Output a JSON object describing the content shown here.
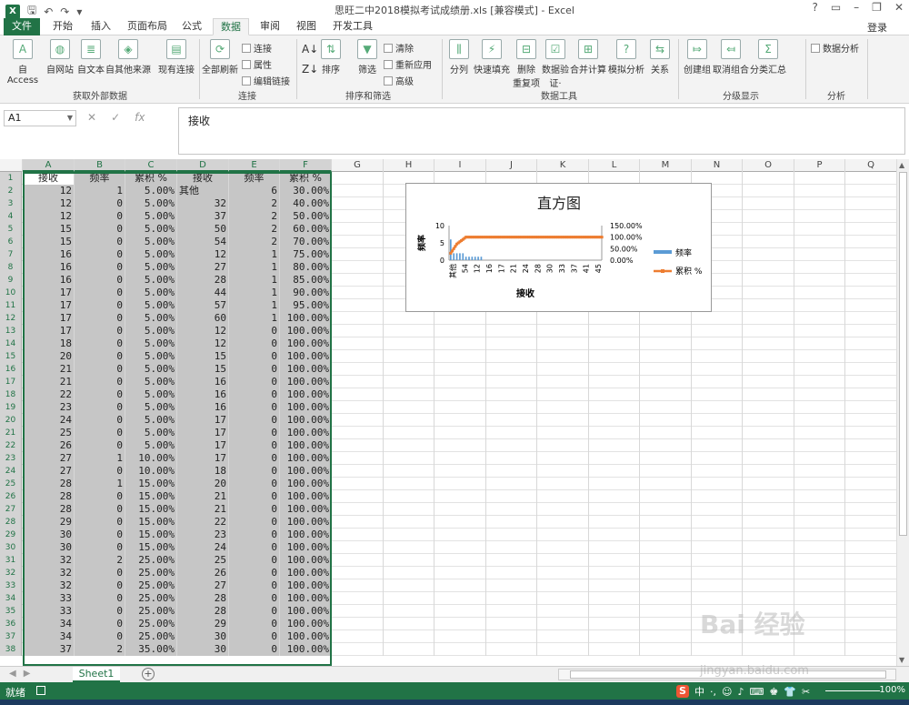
{
  "window": {
    "title": "思旺二中2018模拟考试成绩册.xls  [兼容模式] - Excel",
    "buttons": [
      "?",
      "▭",
      "–",
      "❐",
      "✕"
    ]
  },
  "tabs": [
    {
      "label": "文件",
      "kind": "file"
    },
    {
      "label": "开始"
    },
    {
      "label": "插入"
    },
    {
      "label": "页面布局"
    },
    {
      "label": "公式"
    },
    {
      "label": "数据",
      "active": true
    },
    {
      "label": "审阅"
    },
    {
      "label": "视图"
    },
    {
      "label": "开发工具"
    }
  ],
  "login": "登录",
  "ribbon": {
    "buttons": [
      {
        "label": "自 Access",
        "icon": "access-icon"
      },
      {
        "label": "自网站",
        "icon": "web-icon"
      },
      {
        "label": "自文本",
        "icon": "text-file-icon"
      },
      {
        "label": "自其他来源",
        "icon": "other-sources-icon"
      },
      {
        "label": "现有连接",
        "icon": "existing-connections-icon"
      },
      {
        "label": "全部刷新",
        "icon": "refresh-icon"
      },
      {
        "label": "排序",
        "icon": "sort-icon"
      },
      {
        "label": "筛选",
        "icon": "filter-icon"
      },
      {
        "label": "分列",
        "icon": "text-to-columns-icon"
      },
      {
        "label": "快速填充",
        "icon": "flash-fill-icon"
      },
      {
        "label": "删除\n重复项",
        "icon": "remove-duplicates-icon"
      },
      {
        "label": "数据验\n证·",
        "icon": "data-validation-icon"
      },
      {
        "label": "合并计算",
        "icon": "consolidate-icon"
      },
      {
        "label": "模拟分析",
        "icon": "what-if-icon"
      },
      {
        "label": "关系",
        "icon": "relationships-icon"
      },
      {
        "label": "创建组",
        "icon": "group-icon"
      },
      {
        "label": "取消组合",
        "icon": "ungroup-icon"
      },
      {
        "label": "分类汇总",
        "icon": "subtotal-icon"
      }
    ],
    "small_buttons": [
      {
        "label": "连接"
      },
      {
        "label": "属性"
      },
      {
        "label": "编辑链接"
      },
      {
        "label": "清除"
      },
      {
        "label": "重新应用"
      },
      {
        "label": "高级"
      },
      {
        "label": "数据分析"
      }
    ],
    "groups": [
      "获取外部数据",
      "连接",
      "排序和筛选",
      "数据工具",
      "分级显示",
      "分析"
    ]
  },
  "formula_bar": {
    "name_box": "A1",
    "value": "接收",
    "icons": [
      "✕",
      "✓",
      "fx"
    ]
  },
  "columns": [
    "A",
    "B",
    "C",
    "D",
    "E",
    "F",
    "G",
    "H",
    "I",
    "J",
    "K",
    "L",
    "M",
    "N",
    "O",
    "P",
    "Q"
  ],
  "table": {
    "headers": [
      "接收",
      "频率",
      "累积 %",
      "接收",
      "频率",
      "累积 %"
    ],
    "rows": [
      [
        "12",
        "1",
        "5.00%",
        "其他",
        "6",
        "30.00%"
      ],
      [
        "12",
        "0",
        "5.00%",
        "32",
        "2",
        "40.00%"
      ],
      [
        "12",
        "0",
        "5.00%",
        "37",
        "2",
        "50.00%"
      ],
      [
        "15",
        "0",
        "5.00%",
        "50",
        "2",
        "60.00%"
      ],
      [
        "15",
        "0",
        "5.00%",
        "54",
        "2",
        "70.00%"
      ],
      [
        "16",
        "0",
        "5.00%",
        "12",
        "1",
        "75.00%"
      ],
      [
        "16",
        "0",
        "5.00%",
        "27",
        "1",
        "80.00%"
      ],
      [
        "16",
        "0",
        "5.00%",
        "28",
        "1",
        "85.00%"
      ],
      [
        "17",
        "0",
        "5.00%",
        "44",
        "1",
        "90.00%"
      ],
      [
        "17",
        "0",
        "5.00%",
        "57",
        "1",
        "95.00%"
      ],
      [
        "17",
        "0",
        "5.00%",
        "60",
        "1",
        "100.00%"
      ],
      [
        "17",
        "0",
        "5.00%",
        "12",
        "0",
        "100.00%"
      ],
      [
        "18",
        "0",
        "5.00%",
        "12",
        "0",
        "100.00%"
      ],
      [
        "20",
        "0",
        "5.00%",
        "15",
        "0",
        "100.00%"
      ],
      [
        "21",
        "0",
        "5.00%",
        "15",
        "0",
        "100.00%"
      ],
      [
        "21",
        "0",
        "5.00%",
        "16",
        "0",
        "100.00%"
      ],
      [
        "22",
        "0",
        "5.00%",
        "16",
        "0",
        "100.00%"
      ],
      [
        "23",
        "0",
        "5.00%",
        "16",
        "0",
        "100.00%"
      ],
      [
        "24",
        "0",
        "5.00%",
        "17",
        "0",
        "100.00%"
      ],
      [
        "25",
        "0",
        "5.00%",
        "17",
        "0",
        "100.00%"
      ],
      [
        "26",
        "0",
        "5.00%",
        "17",
        "0",
        "100.00%"
      ],
      [
        "27",
        "1",
        "10.00%",
        "17",
        "0",
        "100.00%"
      ],
      [
        "27",
        "0",
        "10.00%",
        "18",
        "0",
        "100.00%"
      ],
      [
        "28",
        "1",
        "15.00%",
        "20",
        "0",
        "100.00%"
      ],
      [
        "28",
        "0",
        "15.00%",
        "21",
        "0",
        "100.00%"
      ],
      [
        "28",
        "0",
        "15.00%",
        "21",
        "0",
        "100.00%"
      ],
      [
        "29",
        "0",
        "15.00%",
        "22",
        "0",
        "100.00%"
      ],
      [
        "30",
        "0",
        "15.00%",
        "23",
        "0",
        "100.00%"
      ],
      [
        "30",
        "0",
        "15.00%",
        "24",
        "0",
        "100.00%"
      ],
      [
        "32",
        "2",
        "25.00%",
        "25",
        "0",
        "100.00%"
      ],
      [
        "32",
        "0",
        "25.00%",
        "26",
        "0",
        "100.00%"
      ],
      [
        "32",
        "0",
        "25.00%",
        "27",
        "0",
        "100.00%"
      ],
      [
        "33",
        "0",
        "25.00%",
        "28",
        "0",
        "100.00%"
      ],
      [
        "33",
        "0",
        "25.00%",
        "28",
        "0",
        "100.00%"
      ],
      [
        "34",
        "0",
        "25.00%",
        "29",
        "0",
        "100.00%"
      ],
      [
        "34",
        "0",
        "25.00%",
        "30",
        "0",
        "100.00%"
      ],
      [
        "37",
        "2",
        "35.00%",
        "30",
        "0",
        "100.00%"
      ]
    ]
  },
  "chart_data": {
    "type": "bar",
    "title": "直方图",
    "xlabel": "接收",
    "ylabel": "频率",
    "ylim": [
      0,
      10
    ],
    "y2lim": [
      0,
      1.5
    ],
    "y_ticks": [
      "10",
      "5",
      "0"
    ],
    "y2_ticks": [
      "150.00%",
      "100.00%",
      "50.00%",
      "0.00%"
    ],
    "x_tick_labels": [
      "其他",
      "54",
      "12",
      "16",
      "17",
      "21",
      "24",
      "28",
      "30",
      "33",
      "37",
      "41",
      "45"
    ],
    "categories": [
      "其他",
      "32",
      "37",
      "50",
      "54",
      "12",
      "27",
      "28",
      "44",
      "57",
      "60"
    ],
    "series": [
      {
        "name": "频率",
        "kind": "bar",
        "color": "#5b9bd5",
        "values": [
          6,
          2,
          2,
          2,
          2,
          1,
          1,
          1,
          1,
          1,
          1
        ]
      },
      {
        "name": "累积 %",
        "kind": "line",
        "axis": "y2",
        "color": "#ed7d31",
        "values": [
          0.3,
          0.4,
          0.5,
          0.6,
          0.7,
          0.75,
          0.8,
          0.85,
          0.9,
          0.95,
          1.0
        ]
      }
    ],
    "tail_value": 1.0,
    "legend": "right"
  },
  "sheets": [
    {
      "label": "Sheet1",
      "active": true
    }
  ],
  "status": {
    "text": "就绪",
    "ime": [
      "S",
      "中",
      "·,",
      "☺",
      "♪",
      "⌨",
      "♚",
      "👕",
      "✂"
    ],
    "zoom": "100%"
  },
  "watermark": {
    "logo": "Bai 经验",
    "url": "jingyan.baidu.com"
  }
}
